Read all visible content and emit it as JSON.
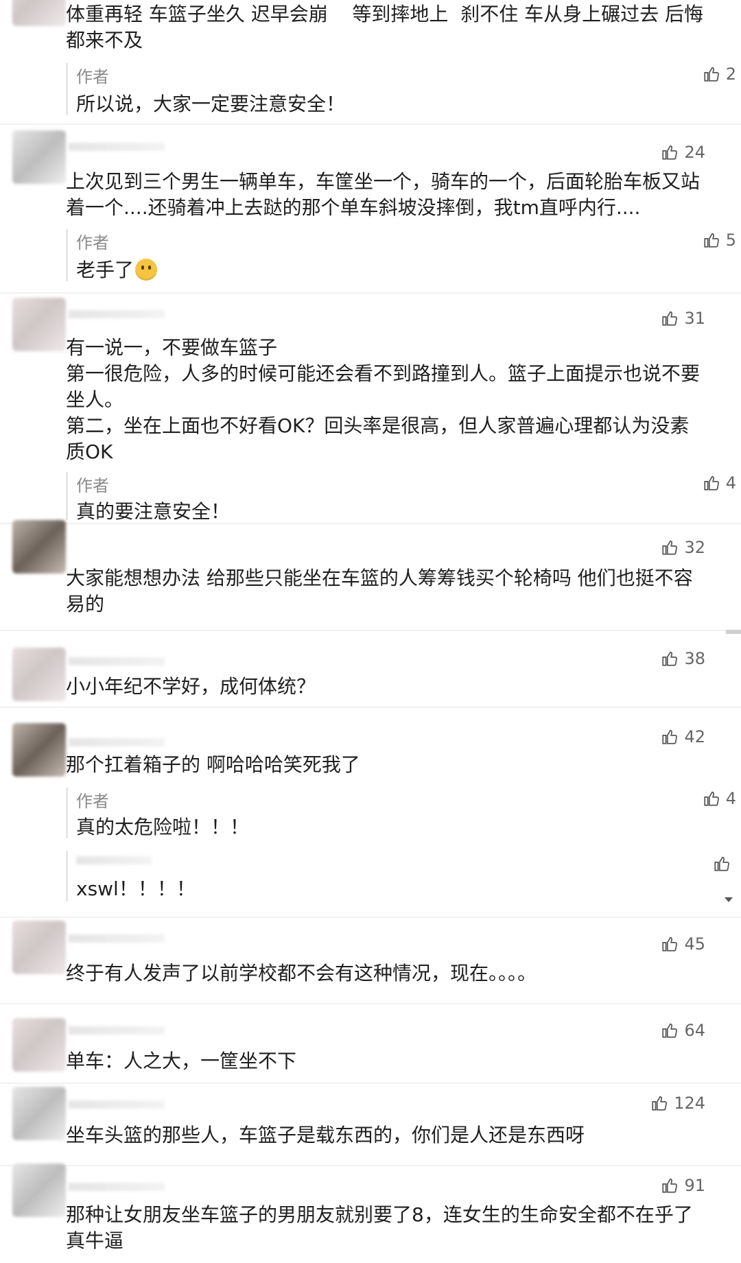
{
  "comments": [
    {
      "text": "体重再轻 车篮子坐久 迟早会崩    等到摔地上  刹不住 车从身上碾过去 后悔都来不及",
      "likes": "",
      "reply": {
        "author": "作者",
        "text": "所以说，大家一定要注意安全！",
        "likes": "2"
      }
    },
    {
      "text": "上次见到三个男生一辆单车，车筐坐一个，骑车的一个，后面轮胎车板又站着一个....还骑着冲上去跶的那个单车斜坡没摔倒，我tm直呼内行....",
      "likes": "24",
      "reply": {
        "author": "作者",
        "text": "老手了",
        "likes": "5"
      }
    },
    {
      "text": "有一说一，不要做车篮子\n第一很危险，人多的时候可能还会看不到路撞到人。篮子上面提示也说不要坐人。\n第二，坐在上面也不好看OK？回头率是很高，但人家普遍心理都认为没素质OK",
      "likes": "31",
      "reply": {
        "author": "作者",
        "text": "真的要注意安全！",
        "likes": "4"
      }
    },
    {
      "text": "大家能想想办法 给那些只能坐在车篮的人筹筹钱买个轮椅吗 他们也挺不容易的",
      "likes": "32"
    },
    {
      "text": "小小年纪不学好，成何体统？",
      "likes": "38"
    },
    {
      "text": "那个扛着箱子的 啊哈哈哈笑死我了",
      "likes": "42",
      "reply": {
        "author": "作者",
        "text": "真的太危险啦！！！",
        "likes": "4"
      },
      "reply2": {
        "text": "xswl！！！！",
        "likes": ""
      }
    },
    {
      "text": "终于有人发声了以前学校都不会有这种情况，现在。。。。",
      "likes": "45"
    },
    {
      "text": "单车：人之大，一筐坐不下",
      "likes": "64"
    },
    {
      "text": "坐车头篮的那些人，车篮子是载东西的，你们是人还是东西呀",
      "likes": "124"
    },
    {
      "text": "那种让女朋友坐车篮子的男朋友就别要了8，连女生的生命安全都不在乎了\n真牛逼",
      "likes": "91"
    }
  ],
  "icons": {
    "like": "thumbs-up-icon",
    "emoji": "emoji-icon"
  }
}
